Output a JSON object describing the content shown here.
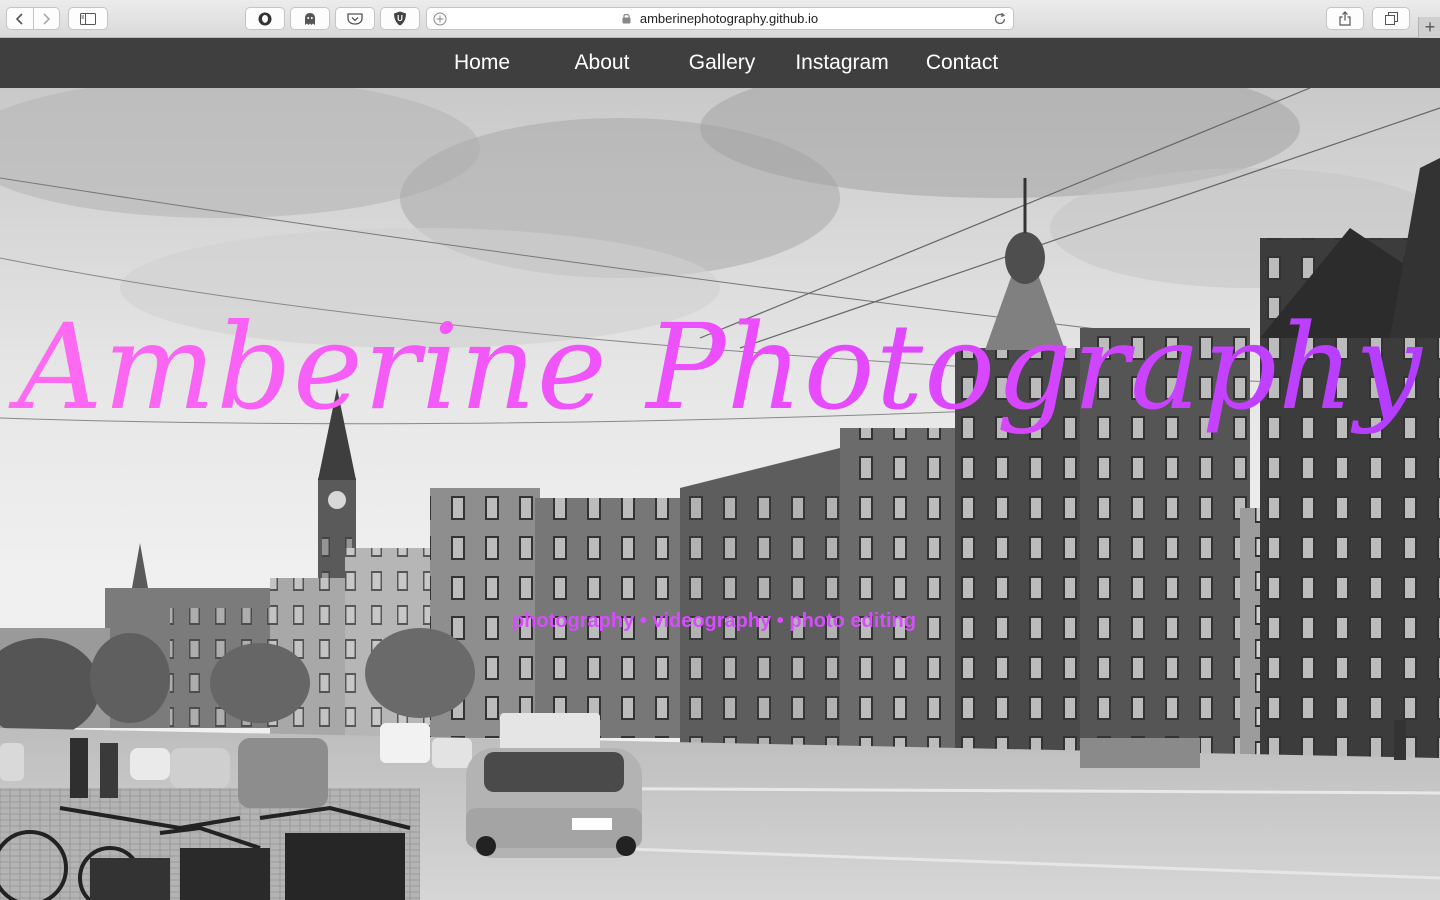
{
  "browser": {
    "url": "amberinephotography.github.io",
    "icons": [
      "back-icon",
      "forward-icon",
      "sidebar-icon",
      "privacy-icon",
      "ghost-icon",
      "pocket-icon",
      "ublock-icon",
      "add-icon",
      "lock-icon",
      "reload-icon",
      "share-icon",
      "tabs-icon",
      "new-tab-icon"
    ]
  },
  "nav": {
    "items": [
      "Home",
      "About",
      "Gallery",
      "Instagram",
      "Contact"
    ]
  },
  "hero": {
    "title": "Amberine Photography",
    "tagline": "photography • videography • photo editing"
  },
  "colors": {
    "nav_bg": "#3f3f3f",
    "title_gradient_start": "#ff6cf0",
    "title_gradient_end": "#b03cff",
    "tagline": "#d84cff"
  }
}
